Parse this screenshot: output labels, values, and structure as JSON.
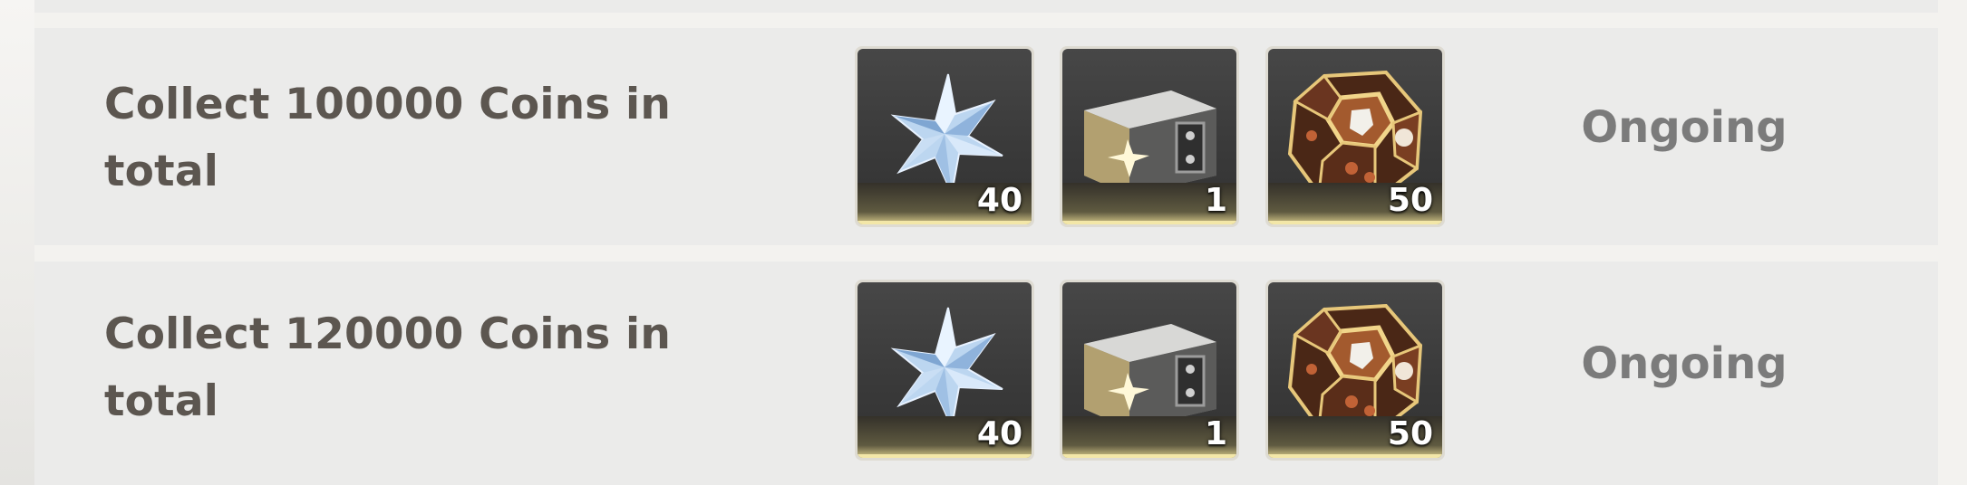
{
  "quests": [
    {
      "title": "Collect 100000 Coins in total",
      "status": "Ongoing",
      "rewards": [
        {
          "icon": "star-crystal-icon",
          "count": "40"
        },
        {
          "icon": "metal-chest-icon",
          "count": "1"
        },
        {
          "icon": "honeycomb-gem-icon",
          "count": "50"
        }
      ]
    },
    {
      "title": "Collect 120000 Coins in total",
      "status": "Ongoing",
      "rewards": [
        {
          "icon": "star-crystal-icon",
          "count": "40"
        },
        {
          "icon": "metal-chest-icon",
          "count": "1"
        },
        {
          "icon": "honeycomb-gem-icon",
          "count": "50"
        }
      ]
    }
  ],
  "colors": {
    "row_bg": "#ebebea",
    "title_text": "#5c5650",
    "status_text": "#7b7b7b",
    "item_frame": "#dedbd2",
    "rarity_glow": "#f3e7a8"
  }
}
